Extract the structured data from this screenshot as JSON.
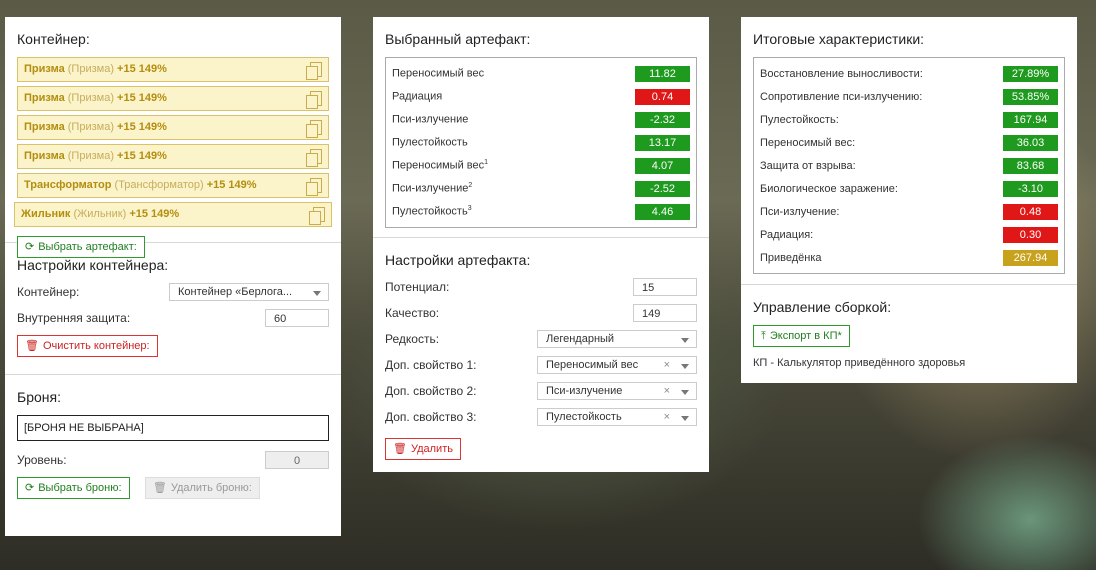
{
  "container_panel": {
    "title": "Контейнер:",
    "slots": [
      {
        "name": "Призма",
        "orig": "(Призма)",
        "bonus": "+15 149%"
      },
      {
        "name": "Призма",
        "orig": "(Призма)",
        "bonus": "+15 149%"
      },
      {
        "name": "Призма",
        "orig": "(Призма)",
        "bonus": "+15 149%"
      },
      {
        "name": "Призма",
        "orig": "(Призма)",
        "bonus": "+15 149%"
      },
      {
        "name": "Трансформатор",
        "orig": "(Трансформатор)",
        "bonus": "+15 149%"
      },
      {
        "name": "Жильник",
        "orig": "(Жильник)",
        "bonus": "+15 149%"
      }
    ],
    "choose_button": "Выбрать артефакт:",
    "settings_title": "Настройки контейнера:",
    "container_label": "Контейнер:",
    "container_value": "Контейнер «Берлога...",
    "inner_protection_label": "Внутренняя защита:",
    "inner_protection_value": "60",
    "clear_button": "Очистить контейнер:",
    "armor_title": "Броня:",
    "armor_value": "[БРОНЯ НЕ ВЫБРАНА]",
    "level_label": "Уровень:",
    "level_value": "0",
    "choose_armor_button": "Выбрать броню:",
    "delete_armor_button": "Удалить броню:"
  },
  "artifact_panel": {
    "title": "Выбранный артефакт:",
    "stats": [
      {
        "label": "Переносимый вес",
        "sup": "",
        "value": "11.82",
        "color": "#1e9a1e"
      },
      {
        "label": "Радиация",
        "sup": "",
        "value": "0.74",
        "color": "#e01717"
      },
      {
        "label": "Пси-излучение",
        "sup": "",
        "value": "-2.32",
        "color": "#1e9a1e"
      },
      {
        "label": "Пулестойкость",
        "sup": "",
        "value": "13.17",
        "color": "#1e9a1e"
      },
      {
        "label": "Переносимый вес",
        "sup": "1",
        "value": "4.07",
        "color": "#1e9a1e"
      },
      {
        "label": "Пси-излучение",
        "sup": "2",
        "value": "-2.52",
        "color": "#1e9a1e"
      },
      {
        "label": "Пулестойкость",
        "sup": "3",
        "value": "4.46",
        "color": "#1e9a1e"
      }
    ],
    "settings_title": "Настройки артефакта:",
    "potential_label": "Потенциал:",
    "potential_value": "15",
    "quality_label": "Качество:",
    "quality_value": "149",
    "rarity_label": "Редкость:",
    "rarity_value": "Легендарный",
    "extra1_label": "Доп. свойство 1:",
    "extra1_value": "Переносимый вес",
    "extra2_label": "Доп. свойство 2:",
    "extra2_value": "Пси-излучение",
    "extra3_label": "Доп. свойство 3:",
    "extra3_value": "Пулестойкость",
    "clear_x": "×",
    "delete_button": "Удалить"
  },
  "totals_panel": {
    "title": "Итоговые характеристики:",
    "stats": [
      {
        "label": "Восстановление выносливости:",
        "value": "27.89%",
        "color": "#1e9a1e"
      },
      {
        "label": "Сопротивление пси-излучению:",
        "value": "53.85%",
        "color": "#1e9a1e"
      },
      {
        "label": "Пулестойкость:",
        "value": "167.94",
        "color": "#1e9a1e"
      },
      {
        "label": "Переносимый вес:",
        "value": "36.03",
        "color": "#1e9a1e"
      },
      {
        "label": "Защита от взрыва:",
        "value": "83.68",
        "color": "#1e9a1e"
      },
      {
        "label": "Биологическое заражение:",
        "value": "-3.10",
        "color": "#1e9a1e"
      },
      {
        "label": "Пси-излучение:",
        "value": "0.48",
        "color": "#e01717"
      },
      {
        "label": "Радиация:",
        "value": "0.30",
        "color": "#e01717"
      },
      {
        "label": "Приведёнка",
        "value": "267.94",
        "color": "#c9a21d"
      }
    ],
    "build_title": "Управление сборкой:",
    "export_button": "Экспорт в КП*",
    "note": "КП - Калькулятор приведённого здоровья"
  }
}
